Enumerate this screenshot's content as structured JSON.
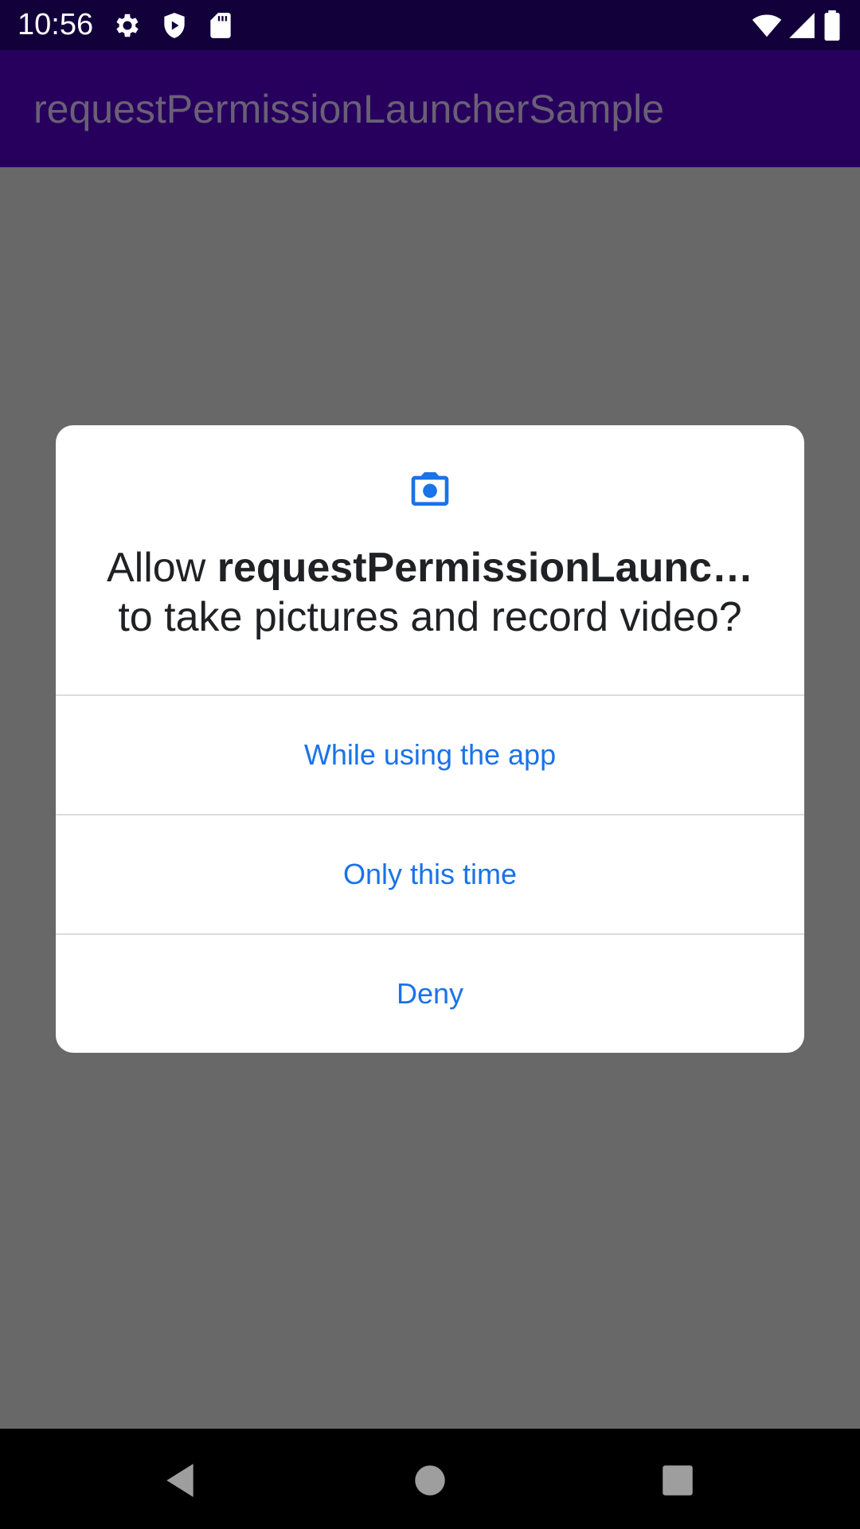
{
  "status_bar": {
    "time": "10:56",
    "icons": [
      "gear-icon",
      "shield-icon",
      "sd-card-icon",
      "wifi-icon",
      "signal-icon",
      "battery-icon"
    ]
  },
  "app_bar": {
    "title": "requestPermissionLauncherSample"
  },
  "dialog": {
    "icon": "camera-icon",
    "message_prefix": "Allow ",
    "app_name": "requestPermissionLaunc…",
    "message_suffix": "to take pictures and record video?",
    "buttons": [
      {
        "label": "While using the app"
      },
      {
        "label": "Only this time"
      },
      {
        "label": "Deny"
      }
    ],
    "accent_color": "#1a73e8"
  },
  "nav_bar": {
    "icons": [
      "back-icon",
      "home-icon",
      "recents-icon"
    ]
  }
}
